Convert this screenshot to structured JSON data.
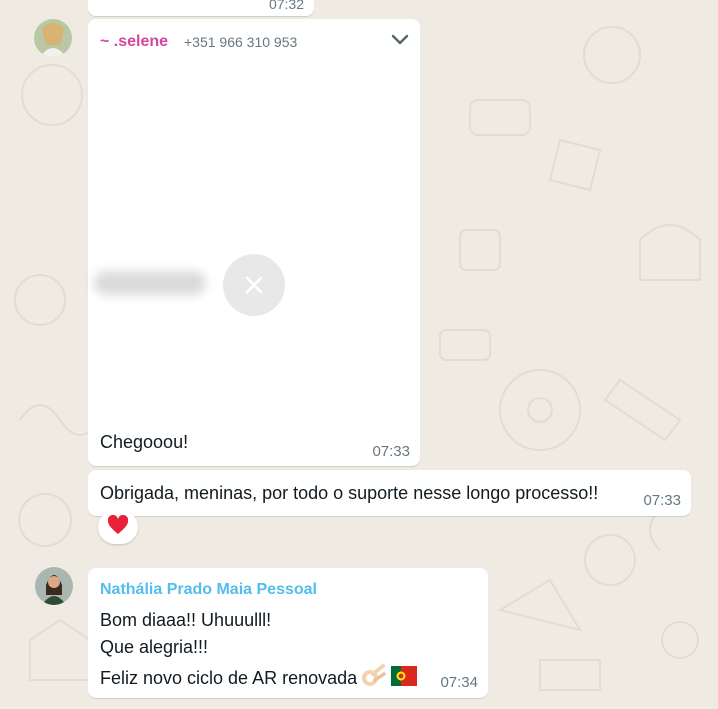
{
  "previous_message": {
    "time": "07:32"
  },
  "selene_message": {
    "sender_name": "~ .selene",
    "sender_phone": "+351 966 310 953",
    "caption": "Chegooou!",
    "time": "07:33",
    "icons": [
      "chevron-down-icon",
      "close-icon"
    ]
  },
  "thanks_message": {
    "text": "Obrigada, meninas, por todo o suporte nesse longo processo!!",
    "time": "07:33",
    "reaction": "heart-emoji"
  },
  "nathalia_message": {
    "sender_name": "Nathália Prado Maia Pessoal",
    "lines": [
      "Bom diaaa!! Uhuuulll!",
      "Que alegria!!!",
      "Feliz novo ciclo de AR renovada"
    ],
    "emojis": [
      "ok-hand-emoji",
      "portugal-flag-emoji"
    ],
    "time": "07:34"
  },
  "colors": {
    "wallpaper": "#efeae2",
    "bubble": "#ffffff",
    "selene_name": "#d6489e",
    "nathalia_name": "#53bdeb",
    "meta_text": "#667781"
  }
}
